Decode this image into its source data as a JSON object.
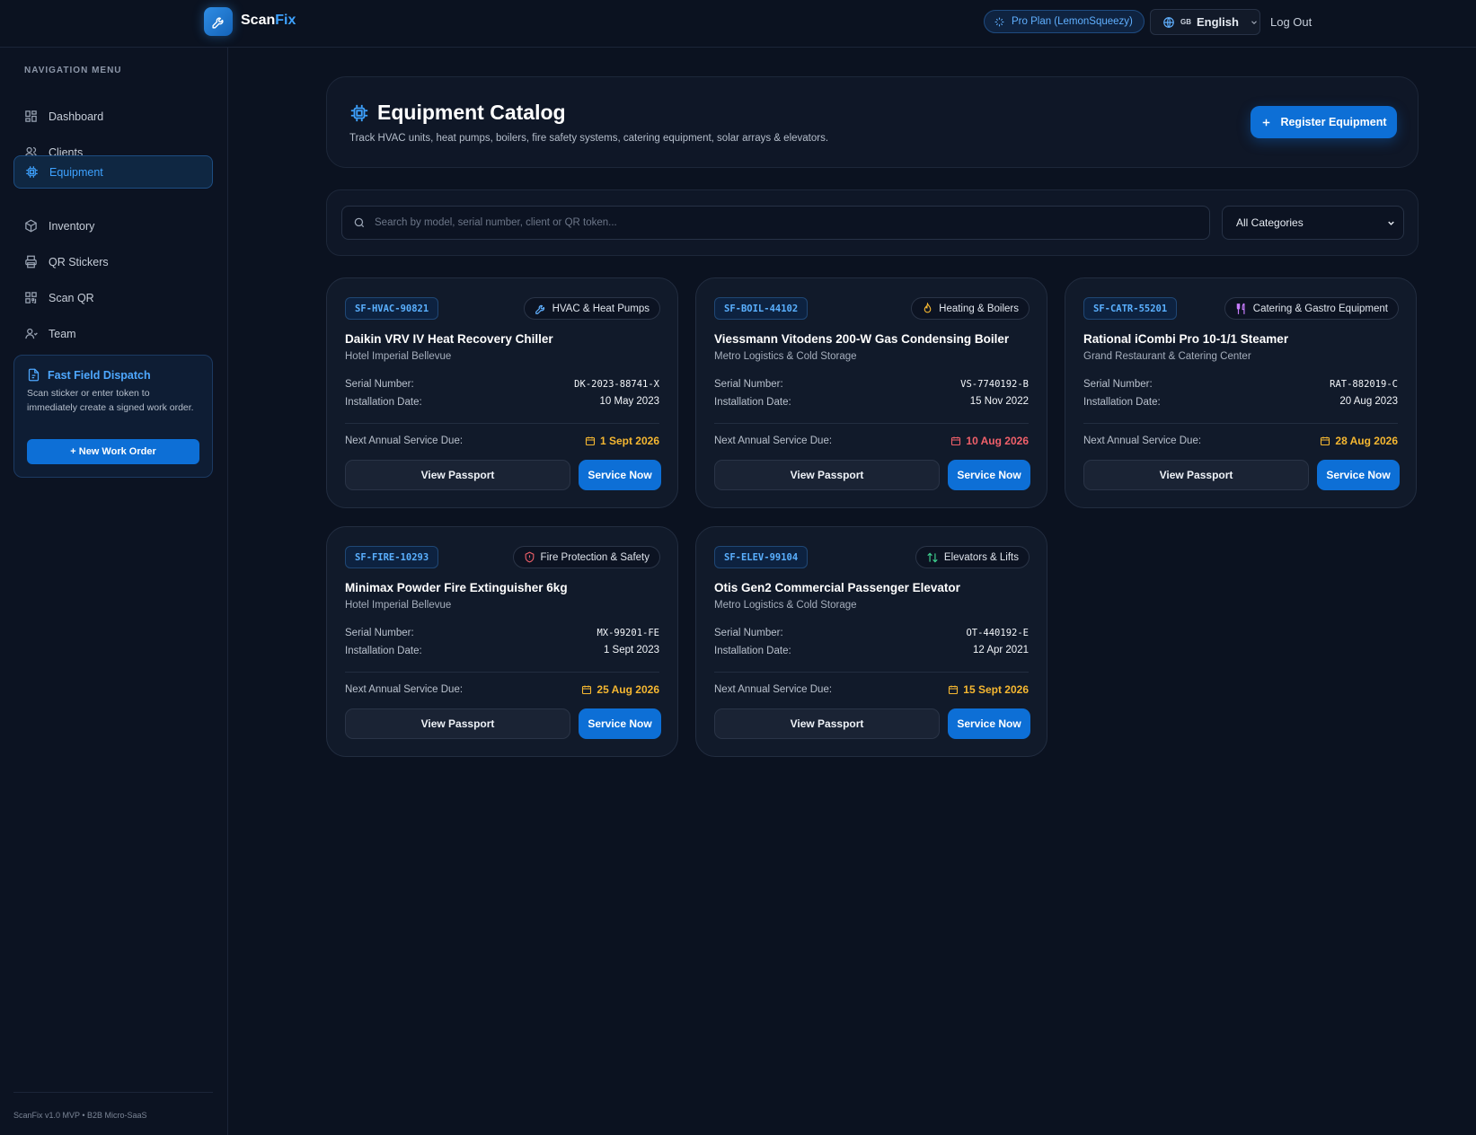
{
  "app": {
    "brand_part1": "Scan",
    "brand_part2": "Fix",
    "plan_label": "Pro Plan (LemonSqueezy)",
    "lang_flag": "GB",
    "lang_label": "English",
    "logout_label": "Log Out"
  },
  "colors": {
    "accent": "#0d6fd6",
    "accent_light": "#3ea2ff",
    "due_warning": "#f5b731",
    "due_danger": "#f0606a"
  },
  "sidebar": {
    "title": "NAVIGATION MENU",
    "items": [
      {
        "label": "Dashboard",
        "icon": "dashboard-icon"
      },
      {
        "label": "Clients",
        "icon": "users-icon"
      },
      {
        "label": "Equipment",
        "icon": "chip-icon",
        "active": true
      },
      {
        "label": "Inventory",
        "icon": "box-icon"
      },
      {
        "label": "QR Stickers",
        "icon": "printer-icon"
      },
      {
        "label": "Scan QR",
        "icon": "qr-icon"
      },
      {
        "label": "Team",
        "icon": "team-icon"
      }
    ],
    "dispatch": {
      "title": "Fast Field Dispatch",
      "desc": "Scan sticker or enter token to immediately create a signed work order.",
      "button": "+ New Work Order"
    },
    "footer": "ScanFix v1.0 MVP • B2B Micro-SaaS"
  },
  "header": {
    "title": "Equipment Catalog",
    "subtitle": "Track HVAC units, heat pumps, boilers, fire safety systems, catering equipment, solar arrays & elevators.",
    "register_button": "Register Equipment"
  },
  "filters": {
    "search_placeholder": "Search by model, serial number, client or QR token...",
    "search_value": "",
    "category_selected": "All Categories"
  },
  "labels": {
    "serial": "Serial Number:",
    "installed": "Installation Date:",
    "due": "Next Annual Service Due:",
    "view_passport": "View Passport",
    "service_now": "Service Now"
  },
  "equipment": [
    {
      "code": "SF-HVAC-90821",
      "category": "HVAC & Heat Pumps",
      "category_icon": "wrench-icon",
      "name": "Daikin VRV IV Heat Recovery Chiller",
      "client": "Hotel Imperial Bellevue",
      "serial": "DK-2023-88741-X",
      "installed": "10 May 2023",
      "due": "1 Sept 2026",
      "due_status": "warning"
    },
    {
      "code": "SF-BOIL-44102",
      "category": "Heating & Boilers",
      "category_icon": "flame-icon",
      "name": "Viessmann Vitodens 200-W Gas Condensing Boiler",
      "client": "Metro Logistics & Cold Storage",
      "serial": "VS-7740192-B",
      "installed": "15 Nov 2022",
      "due": "10 Aug 2026",
      "due_status": "danger"
    },
    {
      "code": "SF-CATR-55201",
      "category": "Catering & Gastro Equipment",
      "category_icon": "utensils-icon",
      "name": "Rational iCombi Pro 10-1/1 Steamer",
      "client": "Grand Restaurant & Catering Center",
      "serial": "RAT-882019-C",
      "installed": "20 Aug 2023",
      "due": "28 Aug 2026",
      "due_status": "warning"
    },
    {
      "code": "SF-FIRE-10293",
      "category": "Fire Protection & Safety",
      "category_icon": "shield-icon",
      "name": "Minimax Powder Fire Extinguisher 6kg",
      "client": "Hotel Imperial Bellevue",
      "serial": "MX-99201-FE",
      "installed": "1 Sept 2023",
      "due": "25 Aug 2026",
      "due_status": "warning"
    },
    {
      "code": "SF-ELEV-99104",
      "category": "Elevators & Lifts",
      "category_icon": "arrows-updown-icon",
      "name": "Otis Gen2 Commercial Passenger Elevator",
      "client": "Metro Logistics & Cold Storage",
      "serial": "OT-440192-E",
      "installed": "12 Apr 2021",
      "due": "15 Sept 2026",
      "due_status": "warning"
    }
  ]
}
